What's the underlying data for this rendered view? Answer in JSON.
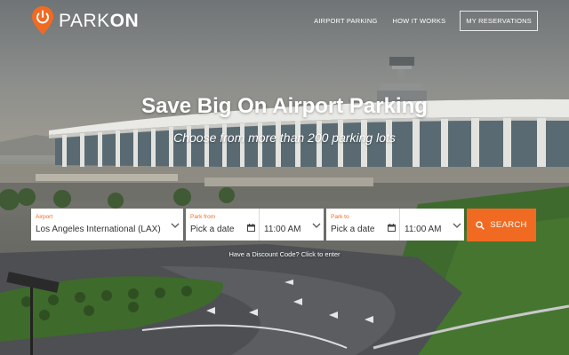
{
  "brand": {
    "name_light": "PARK",
    "name_bold": "ON",
    "color": "#f26a22"
  },
  "nav": {
    "items": [
      {
        "label": "AIRPORT PARKING"
      },
      {
        "label": "HOW IT WORKS"
      }
    ],
    "reservations_label": "MY RESERVATIONS"
  },
  "hero": {
    "title": "Save Big On Airport Parking",
    "subtitle": "Choose from more than 200 parking lots"
  },
  "search": {
    "airport": {
      "label": "Airport",
      "value": "Los Angeles International (LAX)"
    },
    "park_from": {
      "label": "Park from",
      "date": "Pick a date",
      "time": "11:00 AM"
    },
    "park_to": {
      "label": "Park to",
      "date": "Pick a date",
      "time": "11:00 AM"
    },
    "button_label": "SEARCH",
    "button_color": "#f16a21",
    "discount_text": "Have a Discount Code? Click to enter"
  },
  "icons": [
    "power-pin-logo-icon",
    "chevron-down-icon",
    "calendar-icon",
    "search-icon"
  ]
}
